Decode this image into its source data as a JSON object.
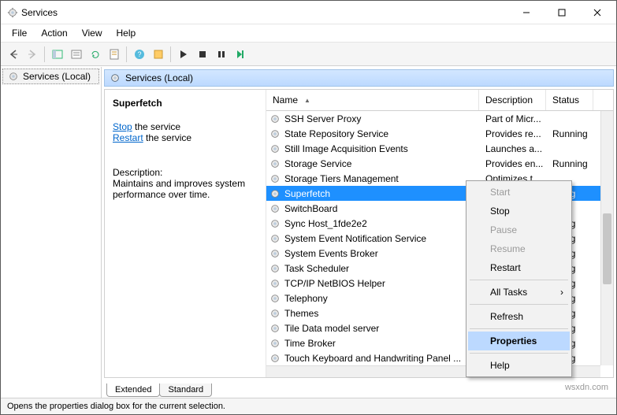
{
  "window": {
    "title": "Services"
  },
  "menu": {
    "file": "File",
    "action": "Action",
    "view": "View",
    "help": "Help"
  },
  "tree": {
    "root": "Services (Local)"
  },
  "caption": {
    "text": "Services (Local)"
  },
  "detail": {
    "service_name": "Superfetch",
    "stop_link": "Stop",
    "stop_rest": " the service",
    "restart_link": "Restart",
    "restart_rest": " the service",
    "desc_head": "Description:",
    "desc_body": "Maintains and improves system performance over time."
  },
  "columns": {
    "name": "Name",
    "description": "Description",
    "status": "Status"
  },
  "rows": [
    {
      "name": "SSH Server Proxy",
      "desc": "Part of Micr...",
      "status": ""
    },
    {
      "name": "State Repository Service",
      "desc": "Provides re...",
      "status": "Running"
    },
    {
      "name": "Still Image Acquisition Events",
      "desc": "Launches a...",
      "status": ""
    },
    {
      "name": "Storage Service",
      "desc": "Provides en...",
      "status": "Running"
    },
    {
      "name": "Storage Tiers Management",
      "desc": "Optimizes t...",
      "status": ""
    },
    {
      "name": "Superfetch",
      "desc": "",
      "status": "nning",
      "selected": true
    },
    {
      "name": "SwitchBoard",
      "desc": "",
      "status": ""
    },
    {
      "name": "Sync Host_1fde2e2",
      "desc": "",
      "status": "nning"
    },
    {
      "name": "System Event Notification Service",
      "desc": "",
      "status": "nning"
    },
    {
      "name": "System Events Broker",
      "desc": "",
      "status": "nning"
    },
    {
      "name": "Task Scheduler",
      "desc": "",
      "status": "nning"
    },
    {
      "name": "TCP/IP NetBIOS Helper",
      "desc": "",
      "status": "nning"
    },
    {
      "name": "Telephony",
      "desc": "",
      "status": "nning"
    },
    {
      "name": "Themes",
      "desc": "",
      "status": "nning"
    },
    {
      "name": "Tile Data model server",
      "desc": "",
      "status": "nning"
    },
    {
      "name": "Time Broker",
      "desc": "",
      "status": "nning"
    },
    {
      "name": "Touch Keyboard and Handwriting Panel ...",
      "desc": "",
      "status": "nning"
    }
  ],
  "context_menu": {
    "start": "Start",
    "stop": "Stop",
    "pause": "Pause",
    "resume": "Resume",
    "restart": "Restart",
    "all_tasks": "All Tasks",
    "refresh": "Refresh",
    "properties": "Properties",
    "help": "Help"
  },
  "tabs": {
    "extended": "Extended",
    "standard": "Standard"
  },
  "statusbar": "Opens the properties dialog box for the current selection.",
  "watermark": "wsxdn.com"
}
